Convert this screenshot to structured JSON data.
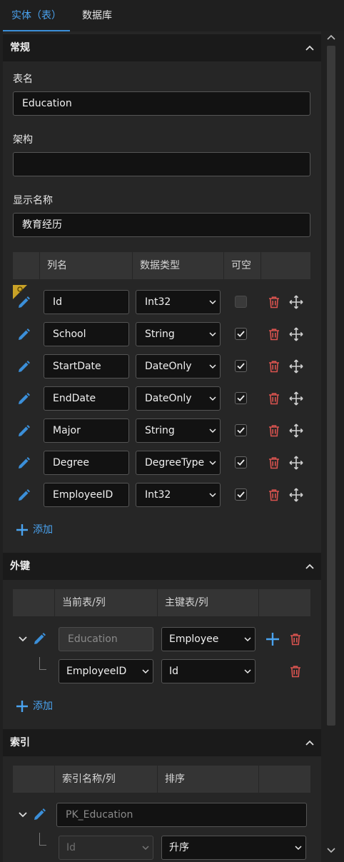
{
  "tabs": [
    {
      "label": "实体（表）",
      "active": true
    },
    {
      "label": "数据库",
      "active": false
    }
  ],
  "colors": {
    "accent": "#3b8fd9",
    "danger": "#d9534f",
    "background": "#262626"
  },
  "general": {
    "title": "常规",
    "table_name_label": "表名",
    "table_name_value": "Education",
    "schema_label": "架构",
    "schema_value": "",
    "display_name_label": "显示名称",
    "display_name_value": "教育经历"
  },
  "columns": {
    "headers": {
      "name": "列名",
      "type": "数据类型",
      "nullable": "可空"
    },
    "rows": [
      {
        "name": "Id",
        "type": "Int32",
        "nullable": false,
        "primary_key": true
      },
      {
        "name": "School",
        "type": "String",
        "nullable": true,
        "primary_key": false
      },
      {
        "name": "StartDate",
        "type": "DateOnly",
        "nullable": true,
        "primary_key": false
      },
      {
        "name": "EndDate",
        "type": "DateOnly",
        "nullable": true,
        "primary_key": false
      },
      {
        "name": "Major",
        "type": "String",
        "nullable": true,
        "primary_key": false
      },
      {
        "name": "Degree",
        "type": "DegreeType",
        "nullable": true,
        "primary_key": false
      },
      {
        "name": "EmployeeID",
        "type": "Int32",
        "nullable": true,
        "primary_key": false
      }
    ],
    "add_label": "添加"
  },
  "foreign_keys": {
    "title": "外键",
    "headers": {
      "current": "当前表/列",
      "principal": "主键表/列"
    },
    "entry": {
      "current_table": "Education",
      "principal_table": "Employee"
    },
    "mapping": {
      "current_column": "EmployeeID",
      "principal_column": "Id"
    },
    "add_label": "添加"
  },
  "indexes": {
    "title": "索引",
    "headers": {
      "name": "索引名称/列",
      "order": "排序"
    },
    "entry": {
      "name_placeholder": "PK_Education",
      "column": "Id",
      "order": "升序"
    }
  }
}
